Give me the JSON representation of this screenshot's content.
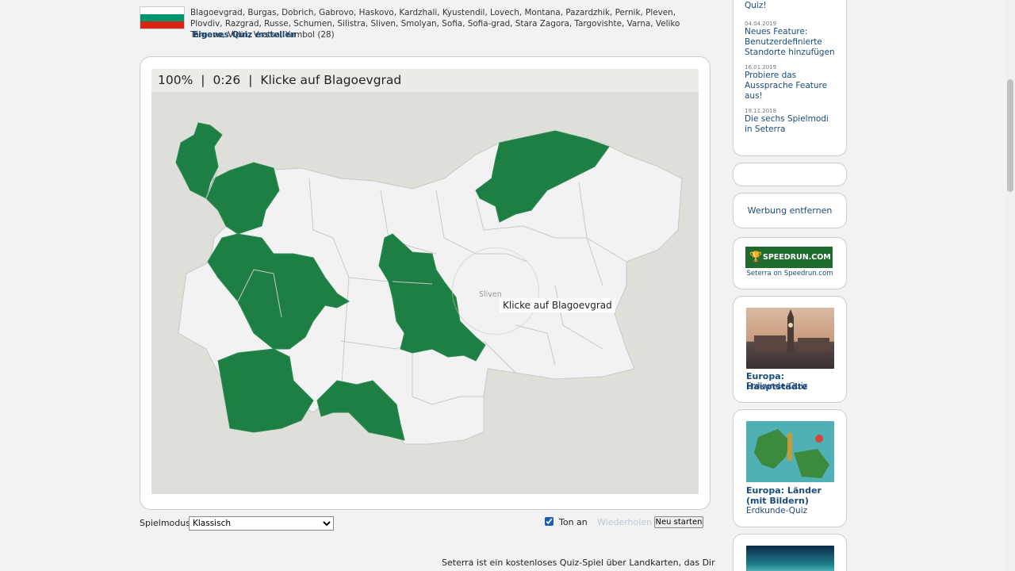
{
  "header": {
    "flag_colors": [
      "#ffffff",
      "#00966e",
      "#d62612"
    ],
    "regions_text": "Blagoevgrad, Burgas, Dobrich, Gabrovo, Haskovo, Kardzhali, Kyustendil, Lovech, Montana, Pazardzhik, Pernik, Pleven, Plovdiv, Razgrad, Russe, Schumen, Silistra, Sliven, Smolyan, Sofia, Sofia-grad, Stara Zagora, Targovishte, Varna, Veliko Tarnovo, Vidin, Vratsa, Yambol (28)",
    "own_quiz_link": "Eigenes Quiz erstellen"
  },
  "game": {
    "score": "100%",
    "separator": "|",
    "timer": "0:26",
    "prompt": "Klicke auf Blagoevgrad",
    "tooltip": "Klicke auf Blagoevgrad",
    "hover_label": "Sliven",
    "colors": {
      "solved": "#1e7f44",
      "unsolved": "#f2f2f2",
      "border": "#c8c8c8",
      "sea": "#dedfd9"
    }
  },
  "controls": {
    "mode_label": "Spielmodus:",
    "mode_value": "Klassisch",
    "sound_label": "Ton an",
    "sound_checked": true,
    "repeat_label": "Wiederholen",
    "restart_label": "Neu starten"
  },
  "description": "Seterra ist ein kostenloses Quiz-Spiel über Landkarten, das Dir",
  "sidebar": {
    "news_top": "Quiz!",
    "news": [
      {
        "date": "04.04.2019",
        "title": "Neues Feature: Benutzerdefinierte Standorte hinzufügen"
      },
      {
        "date": "16.01.2019",
        "title": "Probiere das Aussprache Feature aus!"
      },
      {
        "date": "19.11.2018",
        "title": "Die sechs Spielmodi in Seterra"
      }
    ],
    "remove_ads": "Werbung entfernen",
    "speedrun_logo": "SPEEDRUN.COM",
    "speedrun_caption": "Seterra on Speedrun.com",
    "quiz1_title": "Europa: Hauptstädte",
    "quiz1_sub": "Erdkunde-Quiz",
    "quiz2_title": "Europa: Länder (mit Bildern)",
    "quiz2_sub": "Erdkunde-Quiz"
  }
}
